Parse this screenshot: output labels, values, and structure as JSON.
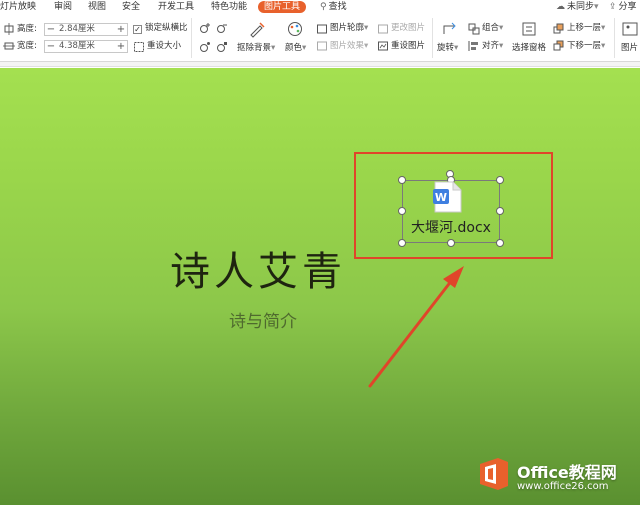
{
  "menubar": {
    "tabs": [
      {
        "label": "灯片放映"
      },
      {
        "label": "审阅"
      },
      {
        "label": "视图"
      },
      {
        "label": "安全"
      },
      {
        "label": "开发工具"
      },
      {
        "label": "特色功能"
      },
      {
        "label": "图片工具",
        "active": true
      },
      {
        "label": "查找"
      }
    ],
    "sync_label": "未同步",
    "share_label": "分享"
  },
  "ribbon": {
    "height_label": "高度:",
    "height_value": "2.84厘米",
    "width_label": "宽度:",
    "width_value": "4.38厘米",
    "minus": "−",
    "plus": "+",
    "lock_ratio_label": "锁定纵横比",
    "lock_ratio_checked": true,
    "check_mark": "✓",
    "reset_size_label": "重设大小",
    "remove_bg_label": "抠除背景",
    "color_label": "颜色",
    "outline_label": "图片轮廓",
    "effect_label": "图片效果",
    "change_pic_label": "更改图片",
    "reset_pic_label": "重设图片",
    "rotate_label": "旋转",
    "group_label": "组合",
    "align_label": "对齐",
    "select_pane_label": "选择窗格",
    "bring_forward_label": "上移一层",
    "send_backward_label": "下移一层",
    "picture_label": "图片",
    "dropdown": "▾"
  },
  "slide": {
    "title": "诗人艾青",
    "subtitle": "诗与简介",
    "object_name": "大堰河.docx",
    "file_badge": "W",
    "colors": {
      "selection": "#e0452a",
      "arrow": "#e0452a",
      "bg_top": "#a4e050",
      "bg_bottom": "#5a9030"
    }
  },
  "watermark": {
    "name": "Office教程网",
    "url": "www.office26.com"
  }
}
